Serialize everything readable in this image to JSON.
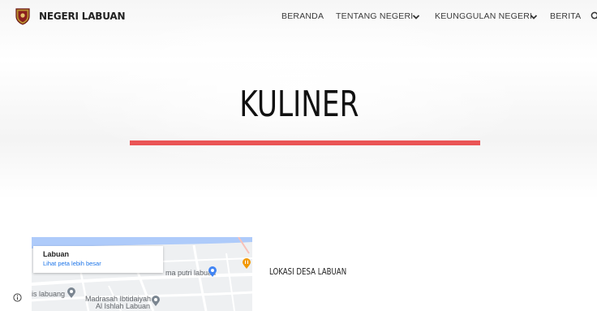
{
  "header": {
    "brand": "NEGERI LABUAN",
    "nav": {
      "beranda": "BERANDA",
      "tentang": "TENTANG NEGERI",
      "keunggulan": "KEUNGGULAN NEGERI",
      "berita": "BERITA"
    },
    "icons": {
      "logo": "shield-crest-icon",
      "dropdown": "chevron-down-icon",
      "search": "search-icon"
    }
  },
  "hero": {
    "title": "KULINER",
    "accent_color": "#ea5455"
  },
  "map": {
    "card_title": "Labuan",
    "card_link": "Lihat peta lebih besar",
    "places": {
      "place_1": "ma putri labuan",
      "place_2": "is labuang",
      "place_3": "Madrasah Ibtidaiyah",
      "place_3_line2": "Al Ishlah Labuan"
    },
    "icons": {
      "info": "info-icon",
      "pin": "map-pin-icon",
      "restaurant": "restaurant-pin-icon"
    }
  },
  "location": {
    "label": "LOKASI DESA LABUAN"
  }
}
